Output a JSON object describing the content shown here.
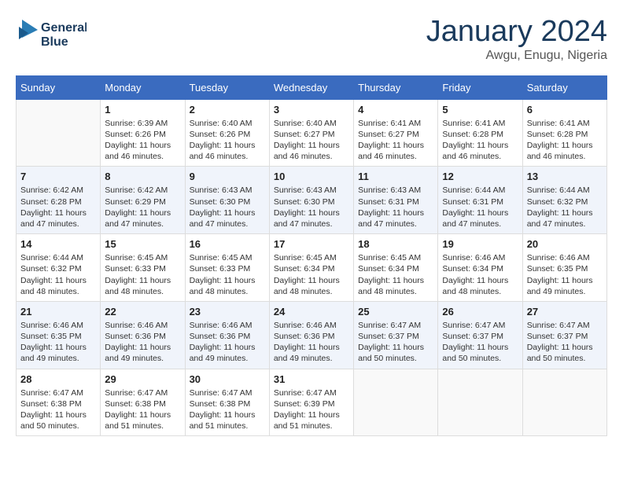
{
  "logo": {
    "line1": "General",
    "line2": "Blue"
  },
  "title": "January 2024",
  "location": "Awgu, Enugu, Nigeria",
  "header_days": [
    "Sunday",
    "Monday",
    "Tuesday",
    "Wednesday",
    "Thursday",
    "Friday",
    "Saturday"
  ],
  "weeks": [
    [
      {
        "day": "",
        "sunrise": "",
        "sunset": "",
        "daylight": ""
      },
      {
        "day": "1",
        "sunrise": "6:39 AM",
        "sunset": "6:26 PM",
        "daylight": "11 hours and 46 minutes."
      },
      {
        "day": "2",
        "sunrise": "6:40 AM",
        "sunset": "6:26 PM",
        "daylight": "11 hours and 46 minutes."
      },
      {
        "day": "3",
        "sunrise": "6:40 AM",
        "sunset": "6:27 PM",
        "daylight": "11 hours and 46 minutes."
      },
      {
        "day": "4",
        "sunrise": "6:41 AM",
        "sunset": "6:27 PM",
        "daylight": "11 hours and 46 minutes."
      },
      {
        "day": "5",
        "sunrise": "6:41 AM",
        "sunset": "6:28 PM",
        "daylight": "11 hours and 46 minutes."
      },
      {
        "day": "6",
        "sunrise": "6:41 AM",
        "sunset": "6:28 PM",
        "daylight": "11 hours and 46 minutes."
      }
    ],
    [
      {
        "day": "7",
        "sunrise": "6:42 AM",
        "sunset": "6:28 PM",
        "daylight": "11 hours and 47 minutes."
      },
      {
        "day": "8",
        "sunrise": "6:42 AM",
        "sunset": "6:29 PM",
        "daylight": "11 hours and 47 minutes."
      },
      {
        "day": "9",
        "sunrise": "6:43 AM",
        "sunset": "6:30 PM",
        "daylight": "11 hours and 47 minutes."
      },
      {
        "day": "10",
        "sunrise": "6:43 AM",
        "sunset": "6:30 PM",
        "daylight": "11 hours and 47 minutes."
      },
      {
        "day": "11",
        "sunrise": "6:43 AM",
        "sunset": "6:31 PM",
        "daylight": "11 hours and 47 minutes."
      },
      {
        "day": "12",
        "sunrise": "6:44 AM",
        "sunset": "6:31 PM",
        "daylight": "11 hours and 47 minutes."
      },
      {
        "day": "13",
        "sunrise": "6:44 AM",
        "sunset": "6:32 PM",
        "daylight": "11 hours and 47 minutes."
      }
    ],
    [
      {
        "day": "14",
        "sunrise": "6:44 AM",
        "sunset": "6:32 PM",
        "daylight": "11 hours and 48 minutes."
      },
      {
        "day": "15",
        "sunrise": "6:45 AM",
        "sunset": "6:33 PM",
        "daylight": "11 hours and 48 minutes."
      },
      {
        "day": "16",
        "sunrise": "6:45 AM",
        "sunset": "6:33 PM",
        "daylight": "11 hours and 48 minutes."
      },
      {
        "day": "17",
        "sunrise": "6:45 AM",
        "sunset": "6:34 PM",
        "daylight": "11 hours and 48 minutes."
      },
      {
        "day": "18",
        "sunrise": "6:45 AM",
        "sunset": "6:34 PM",
        "daylight": "11 hours and 48 minutes."
      },
      {
        "day": "19",
        "sunrise": "6:46 AM",
        "sunset": "6:34 PM",
        "daylight": "11 hours and 48 minutes."
      },
      {
        "day": "20",
        "sunrise": "6:46 AM",
        "sunset": "6:35 PM",
        "daylight": "11 hours and 49 minutes."
      }
    ],
    [
      {
        "day": "21",
        "sunrise": "6:46 AM",
        "sunset": "6:35 PM",
        "daylight": "11 hours and 49 minutes."
      },
      {
        "day": "22",
        "sunrise": "6:46 AM",
        "sunset": "6:36 PM",
        "daylight": "11 hours and 49 minutes."
      },
      {
        "day": "23",
        "sunrise": "6:46 AM",
        "sunset": "6:36 PM",
        "daylight": "11 hours and 49 minutes."
      },
      {
        "day": "24",
        "sunrise": "6:46 AM",
        "sunset": "6:36 PM",
        "daylight": "11 hours and 49 minutes."
      },
      {
        "day": "25",
        "sunrise": "6:47 AM",
        "sunset": "6:37 PM",
        "daylight": "11 hours and 50 minutes."
      },
      {
        "day": "26",
        "sunrise": "6:47 AM",
        "sunset": "6:37 PM",
        "daylight": "11 hours and 50 minutes."
      },
      {
        "day": "27",
        "sunrise": "6:47 AM",
        "sunset": "6:37 PM",
        "daylight": "11 hours and 50 minutes."
      }
    ],
    [
      {
        "day": "28",
        "sunrise": "6:47 AM",
        "sunset": "6:38 PM",
        "daylight": "11 hours and 50 minutes."
      },
      {
        "day": "29",
        "sunrise": "6:47 AM",
        "sunset": "6:38 PM",
        "daylight": "11 hours and 51 minutes."
      },
      {
        "day": "30",
        "sunrise": "6:47 AM",
        "sunset": "6:38 PM",
        "daylight": "11 hours and 51 minutes."
      },
      {
        "day": "31",
        "sunrise": "6:47 AM",
        "sunset": "6:39 PM",
        "daylight": "11 hours and 51 minutes."
      },
      {
        "day": "",
        "sunrise": "",
        "sunset": "",
        "daylight": ""
      },
      {
        "day": "",
        "sunrise": "",
        "sunset": "",
        "daylight": ""
      },
      {
        "day": "",
        "sunrise": "",
        "sunset": "",
        "daylight": ""
      }
    ]
  ]
}
